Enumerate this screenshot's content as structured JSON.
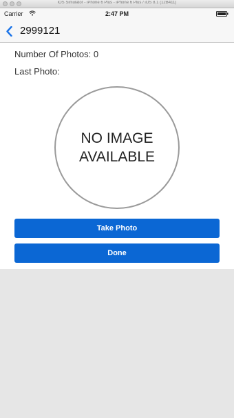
{
  "simulator": {
    "window_title": "iOS Simulator - iPhone 6 Plus - iPhone 6 Plus / iOS 8.1 (12B411)"
  },
  "status_bar": {
    "carrier": "Carrier",
    "time": "2:47 PM",
    "icons": [
      "wifi-icon",
      "battery-icon"
    ]
  },
  "nav": {
    "back_icon": "chevron-left-icon",
    "title": "2999121"
  },
  "main": {
    "photos_count": "Number Of Photos: 0",
    "last_photo_label": "Last Photo:",
    "no_image_line1": "NO IMAGE",
    "no_image_line2": "AVAILABLE",
    "take_photo_label": "Take Photo",
    "done_label": "Done"
  },
  "colors": {
    "accent": "#0b67d4",
    "nav_back": "#1a73e8",
    "background": "#e6e6e6",
    "content_bg": "#ffffff"
  }
}
